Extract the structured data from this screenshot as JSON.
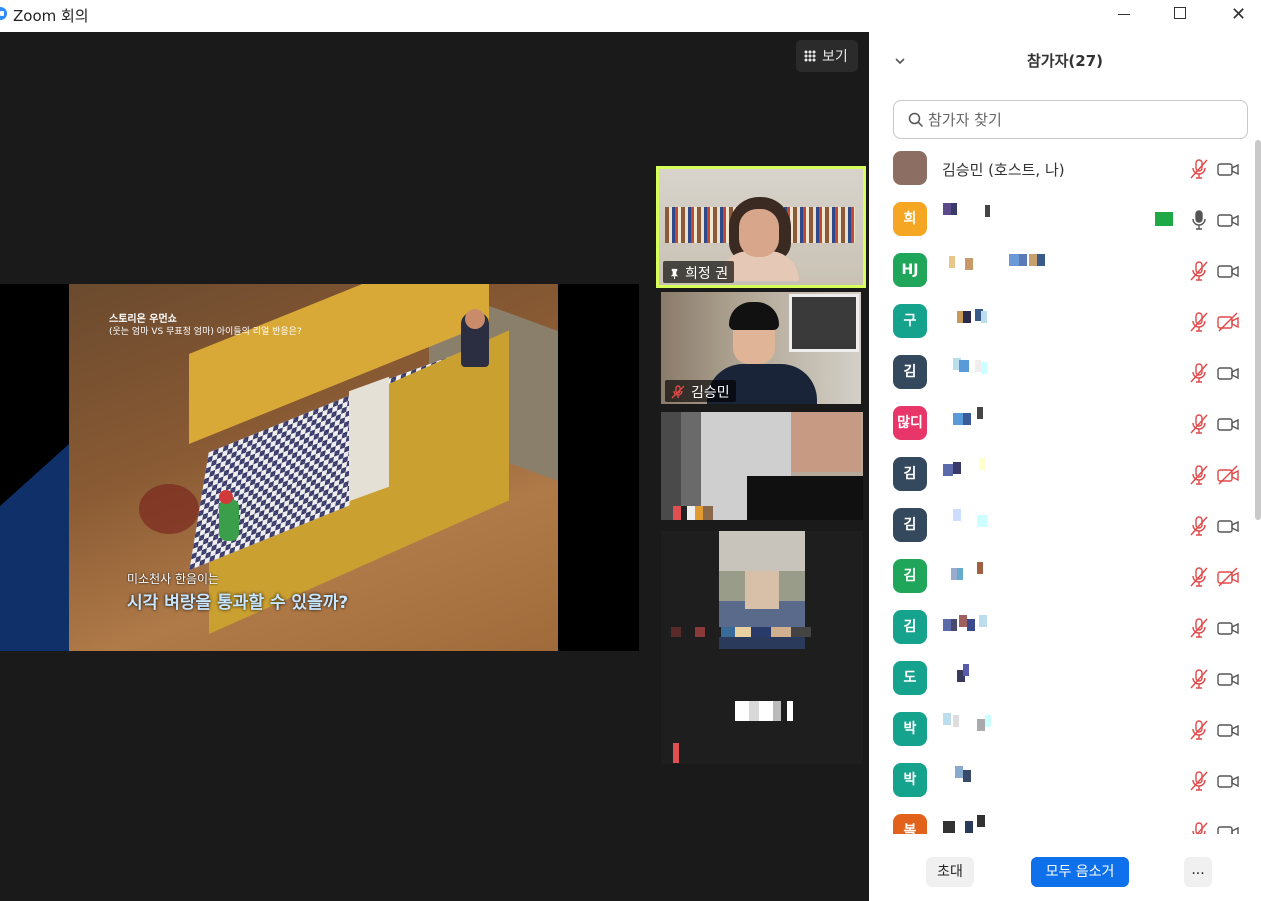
{
  "window": {
    "title": "Zoom 회의"
  },
  "toolbar": {
    "view_label": "보기"
  },
  "shared_screen": {
    "caption_top": "스토리온 우먼쇼",
    "caption_sub": "(웃는 엄마 VS 무표정 엄마) 아이들의 리얼 반응은?",
    "caption_a": "미소천사 한음이는",
    "caption_b": "시각 벼랑을 통과할 수 있을까?"
  },
  "video_tiles": [
    {
      "name": "희정 권",
      "pinned": true,
      "active": true
    },
    {
      "name": "김승민",
      "muted": true
    }
  ],
  "panel": {
    "title": "참가자(27)",
    "search_placeholder": "참가자 찾기",
    "participants": [
      {
        "avatar": "",
        "avatar_color": "#8d6e63",
        "name": "김승민 (호스트, 나)",
        "mic": "muted",
        "video": "on"
      },
      {
        "avatar": "희",
        "avatar_color": "#f5a623",
        "name": "",
        "mic": "on",
        "video": "on",
        "sharing": true
      },
      {
        "avatar": "HJ",
        "avatar_color": "#1fa65a",
        "name": "",
        "mic": "muted",
        "video": "on"
      },
      {
        "avatar": "구",
        "avatar_color": "#15a38d",
        "name": "",
        "mic": "muted",
        "video": "off"
      },
      {
        "avatar": "김",
        "avatar_color": "#34495e",
        "name": "",
        "mic": "muted",
        "video": "on"
      },
      {
        "avatar": "많디",
        "avatar_color": "#e8366b",
        "name": "",
        "mic": "muted",
        "video": "on"
      },
      {
        "avatar": "김",
        "avatar_color": "#34495e",
        "name": "",
        "mic": "muted",
        "video": "off"
      },
      {
        "avatar": "김",
        "avatar_color": "#34495e",
        "name": "",
        "mic": "muted",
        "video": "on"
      },
      {
        "avatar": "김",
        "avatar_color": "#1fa65a",
        "name": "",
        "mic": "muted",
        "video": "off"
      },
      {
        "avatar": "김",
        "avatar_color": "#15a38d",
        "name": "",
        "mic": "muted",
        "video": "on"
      },
      {
        "avatar": "도",
        "avatar_color": "#15a38d",
        "name": "",
        "mic": "muted",
        "video": "on"
      },
      {
        "avatar": "박",
        "avatar_color": "#15a38d",
        "name": "",
        "mic": "muted",
        "video": "on"
      },
      {
        "avatar": "박",
        "avatar_color": "#15a38d",
        "name": "",
        "mic": "muted",
        "video": "on"
      },
      {
        "avatar": "복",
        "avatar_color": "#e2621b",
        "name": "",
        "mic": "muted",
        "video": "on"
      }
    ],
    "footer": {
      "invite_label": "초대",
      "mute_all_label": "모두 음소거",
      "more_label": "..."
    }
  }
}
